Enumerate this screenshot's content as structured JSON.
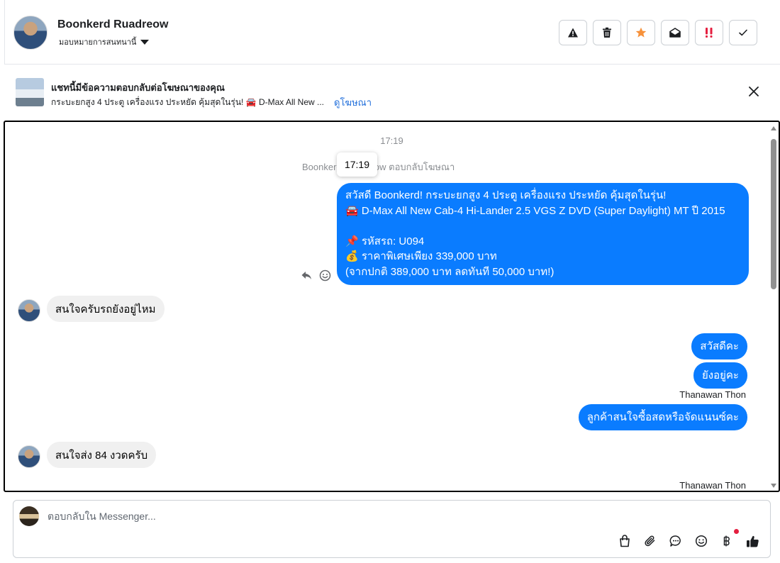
{
  "header": {
    "name": "Boonkerd Ruadreow",
    "assign_label": "มอบหมายการสนทนานี้",
    "actions": [
      {
        "icon": "warning-icon",
        "label": "spam"
      },
      {
        "icon": "trash-icon",
        "label": "delete"
      },
      {
        "icon": "star-icon",
        "label": "star",
        "color": "#f7923b"
      },
      {
        "icon": "envelope-open-icon",
        "label": "mark unread"
      },
      {
        "icon": "double-exclamation-icon",
        "label": "follow up",
        "color": "#e41e3f"
      },
      {
        "icon": "check-icon",
        "label": "done"
      }
    ]
  },
  "ad_banner": {
    "title": "แชทนี้มีข้อความตอบกลับต่อโฆษณาของคุณ",
    "subtitle": "กระบะยกสูง 4 ประตู เครื่องแรง ประหยัด คุ้มสุดในรุ่น! 🚘 D-Max All New ...",
    "link": "ดูโฆษณา"
  },
  "chat": {
    "timestamp": "17:19",
    "system_line": "Boonkerd Ruadreow ตอบกลับโฆษณา",
    "tooltip": "17:19",
    "ad_message": "สวัสดี Boonkerd! กระบะยกสูง 4 ประตู เครื่องแรง ประหยัด คุ้มสุดในรุ่น!\n🚘 D-Max All New Cab-4 Hi-Lander 2.5 VGS Z DVD (Super Daylight) MT ปี 2015\n\n📌 รหัสรถ: U094\n💰 ราคาพิเศษเพียง 339,000 บาท\n(จากปกติ 389,000 บาท ลดทันที 50,000 บาท!)",
    "msg_in_1": "สนใจครับรถยังอยู่ไหม",
    "msg_out_1": "สวัสดีคะ",
    "msg_out_2": "ยังอยู่คะ",
    "sender_1": "Thanawan Thon",
    "msg_out_3": "ลูกค้าสนใจซื้อสดหรือจัดแนนซ์คะ",
    "msg_in_2": "สนใจส่ง 84 งวดครับ",
    "sender_2": "Thanawan Thon"
  },
  "composer": {
    "placeholder": "ตอบกลับใน Messenger...",
    "tools": [
      "bag-icon",
      "paperclip-icon",
      "chat-bubble-icon",
      "smiley-icon",
      "baht-icon",
      "thumbs-up-icon"
    ]
  },
  "colors": {
    "accent": "#0a7cff",
    "link": "#216fdb",
    "incoming_bubble": "#f0f0f0"
  }
}
